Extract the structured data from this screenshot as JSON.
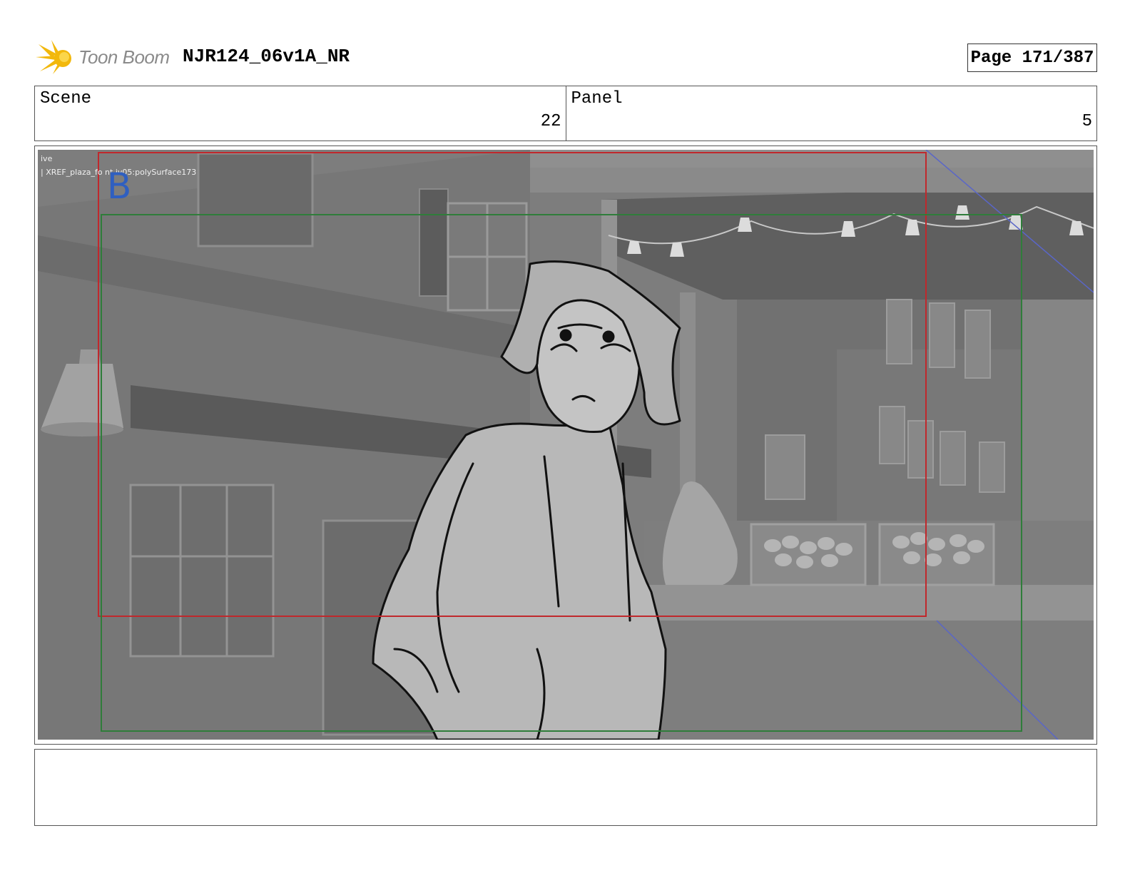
{
  "header": {
    "logo_text": "Toon Boom",
    "title": "NJR124_06v1A_NR",
    "page": "Page 171/387"
  },
  "info": {
    "scene_label": "Scene",
    "scene_value": "22",
    "panel_label": "Panel",
    "panel_value": "5"
  },
  "panel": {
    "overlay_line1": "ive",
    "overlay_line2": "| XREF_plaza_fo  nt  iv05:polySurface173",
    "camera_label": "B"
  },
  "notes": {
    "text": ""
  },
  "colors": {
    "safe_frame_red": "#c0282c",
    "action_frame_green": "#2f7d3a",
    "camera_blue": "#2f5fc0"
  }
}
